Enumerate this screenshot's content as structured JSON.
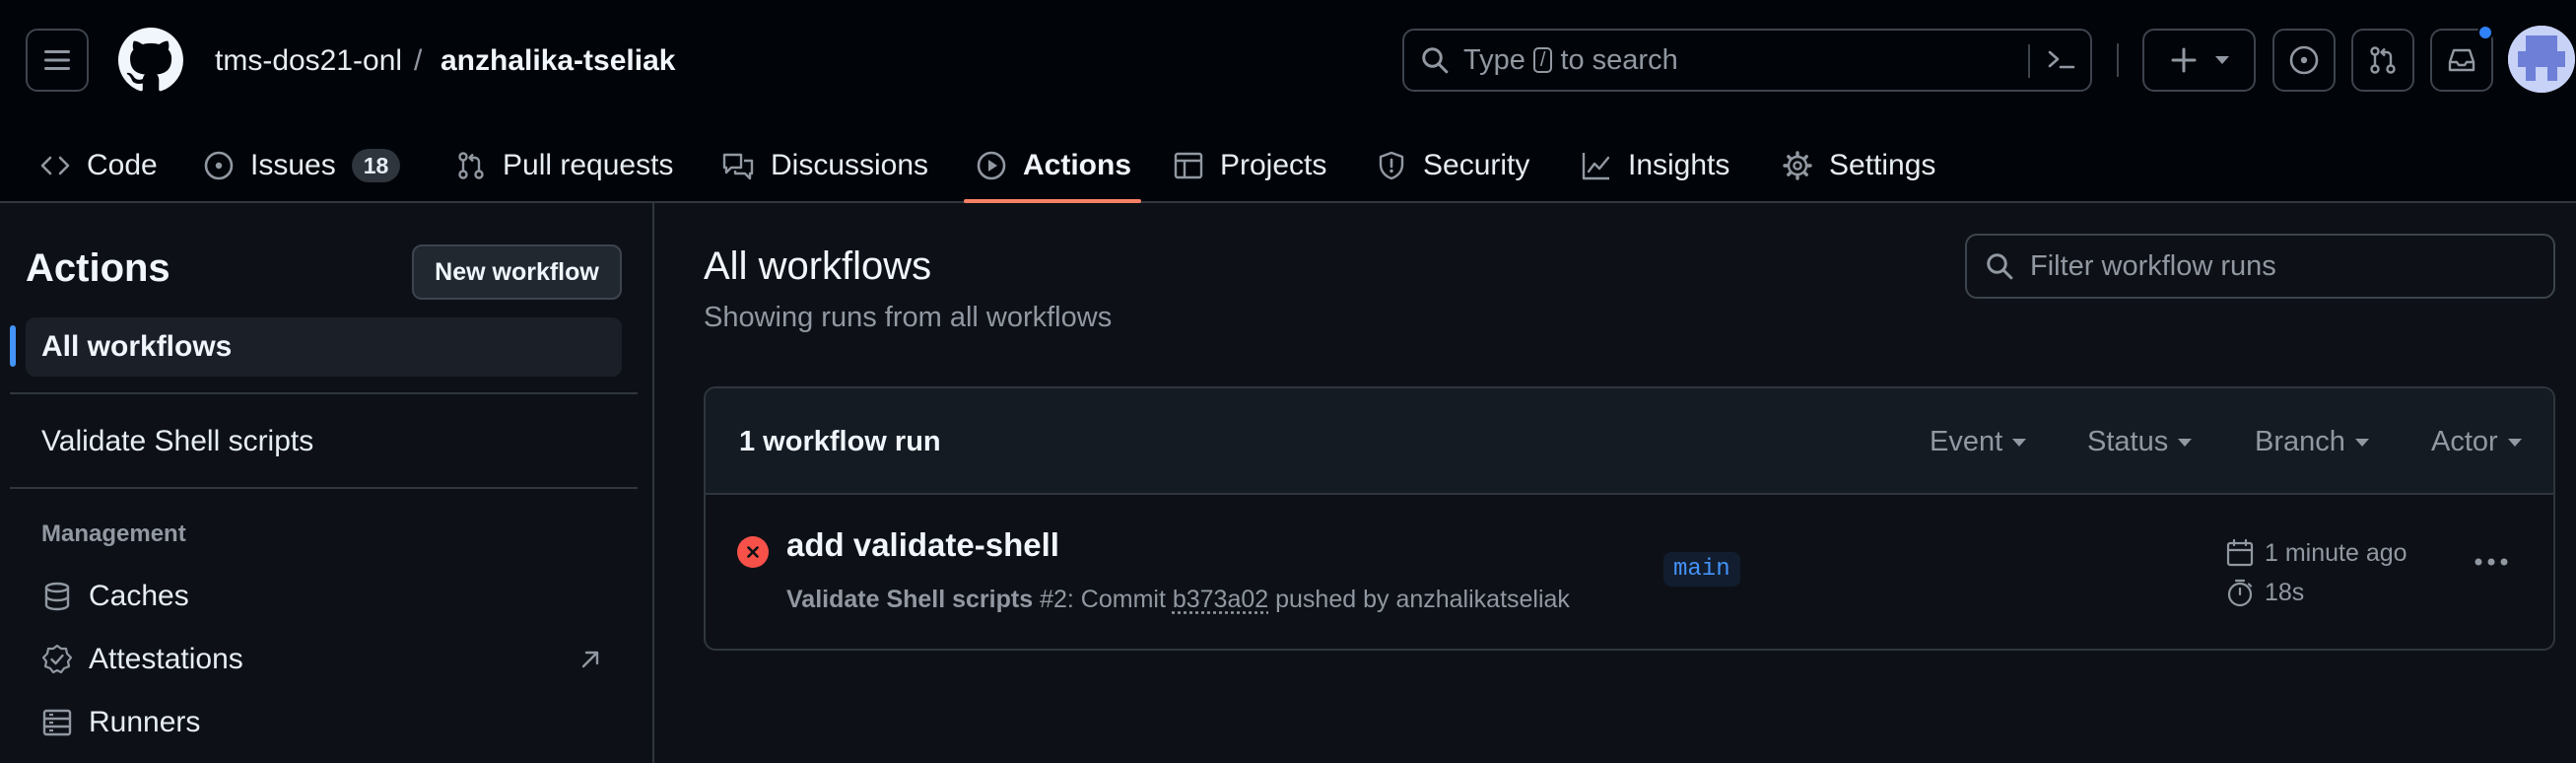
{
  "header": {
    "owner": "tms-dos21-onl",
    "separator": "/",
    "repo": "anzhalika-tseliak",
    "search_prefix": "Type",
    "search_key": "/",
    "search_suffix": "to search"
  },
  "repo_nav": {
    "tabs": [
      {
        "label": "Code",
        "icon": "code-icon"
      },
      {
        "label": "Issues",
        "icon": "issue-opened-icon",
        "count": "18"
      },
      {
        "label": "Pull requests",
        "icon": "git-pull-request-icon"
      },
      {
        "label": "Discussions",
        "icon": "comment-discussion-icon"
      },
      {
        "label": "Actions",
        "icon": "play-icon",
        "selected": true
      },
      {
        "label": "Projects",
        "icon": "table-icon"
      },
      {
        "label": "Security",
        "icon": "shield-icon"
      },
      {
        "label": "Insights",
        "icon": "graph-icon"
      },
      {
        "label": "Settings",
        "icon": "gear-icon"
      }
    ]
  },
  "sidebar": {
    "title": "Actions",
    "new_workflow": "New workflow",
    "items": [
      {
        "label": "All workflows"
      },
      {
        "label": "Validate Shell scripts"
      }
    ],
    "management_label": "Management",
    "links": [
      {
        "label": "Caches",
        "icon": "database-icon"
      },
      {
        "label": "Attestations",
        "icon": "verified-icon"
      },
      {
        "label": "Runners",
        "icon": "server-icon"
      }
    ]
  },
  "main": {
    "title": "All workflows",
    "subtitle": "Showing runs from all workflows",
    "filter_placeholder": "Filter workflow runs",
    "runs_count": "1 workflow run",
    "filters": [
      "Event",
      "Status",
      "Branch",
      "Actor"
    ],
    "run": {
      "title": "add validate-shell",
      "workflow": "Validate Shell scripts",
      "number": "#2",
      "commit_prefix": ": Commit",
      "sha": "b373a02",
      "pushed_by": "pushed by anzhalikatseliak",
      "branch": "main",
      "time_ago": "1 minute ago",
      "duration": "18s",
      "status": "failure"
    }
  },
  "colors": {
    "accent": "#f78166",
    "link": "#4493f8",
    "failure": "#f85149",
    "notification": "#2f81f7"
  }
}
